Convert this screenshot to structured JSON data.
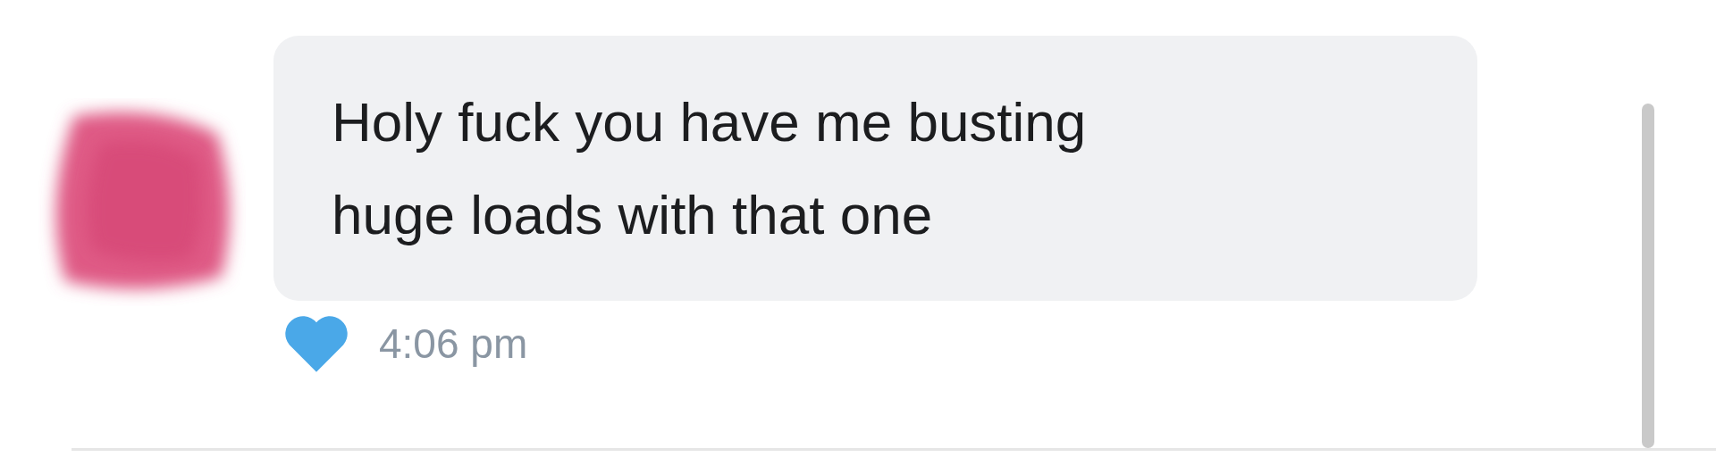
{
  "message": {
    "lines": [
      "Holy fuck you have me busting",
      "huge loads with that one"
    ],
    "liked": true,
    "time": "4:06 pm"
  }
}
